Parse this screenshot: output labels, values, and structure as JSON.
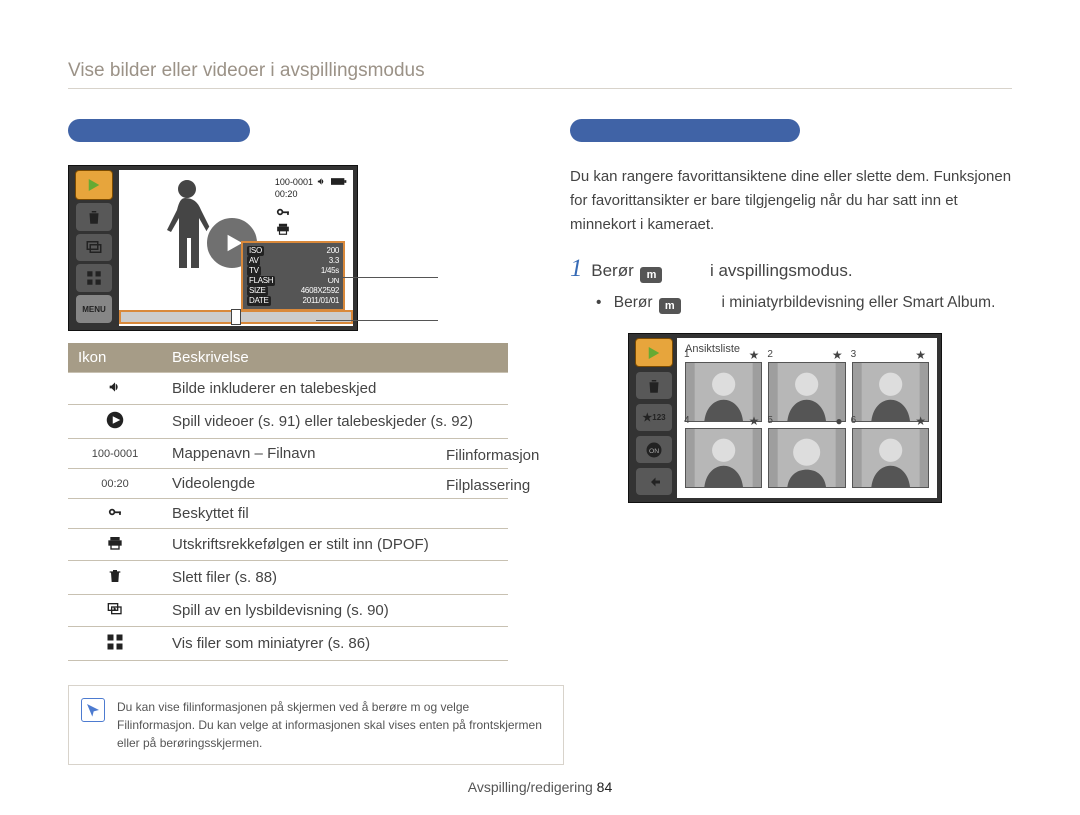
{
  "page_title": "Vise bilder eller videoer i avspillingsmodus",
  "left": {
    "section_heading": "",
    "lcd": {
      "file_id": "100-0001",
      "time": "00:20",
      "menu_label": "MENU",
      "info_box": {
        "iso_lbl": "ISO",
        "iso_val": "200",
        "av_lbl": "AV",
        "av_val": "3.3",
        "tv_lbl": "TV",
        "tv_val": "1/45s",
        "flash_lbl": "FLASH",
        "flash_val": "ON",
        "size_lbl": "SIZE",
        "size_val": "4608X2592",
        "date_lbl": "DATE",
        "date_val": "2011/01/01"
      }
    },
    "pointer_1": "Filinformasjon",
    "pointer_2": "Filplassering",
    "table_headers": {
      "icon": "Ikon",
      "desc": "Beskrivelse"
    },
    "rows": [
      {
        "icon_text": "",
        "icon_name": "voice-memo-icon",
        "desc": "Bilde inkluderer en talebeskjed"
      },
      {
        "icon_text": "",
        "icon_name": "play-circle-icon",
        "desc": "Spill videoer (s. 91) eller talebeskjeder (s. 92)"
      },
      {
        "icon_text": "100-0001",
        "icon_name": "",
        "desc": "Mappenavn – Filnavn"
      },
      {
        "icon_text": "00:20",
        "icon_name": "",
        "desc": "Videolengde"
      },
      {
        "icon_text": "",
        "icon_name": "key-icon",
        "desc": "Beskyttet ﬁl"
      },
      {
        "icon_text": "",
        "icon_name": "printer-icon",
        "desc": "Utskriftsrekkefølgen er stilt inn (DPOF)"
      },
      {
        "icon_text": "",
        "icon_name": "trash-icon",
        "desc": "Slett ﬁler (s. 88)"
      },
      {
        "icon_text": "",
        "icon_name": "slideshow-icon",
        "desc": "Spill av en lysbildevisning (s. 90)"
      },
      {
        "icon_text": "",
        "icon_name": "thumbnails-icon",
        "desc": "Vis ﬁler som miniatyrer (s. 86)"
      }
    ],
    "note": "Du kan vise ﬁlinformasjonen på skjermen ved å berøre m og velge Filinformasjon. Du kan velge at informasjonen skal vises enten på frontskjermen eller på berøringsskjermen."
  },
  "right": {
    "section_heading": "",
    "intro": "Du kan rangere favorittansiktene dine eller slette dem. Funksjonen for favorittansikter er bare tilgjengelig når du har satt inn et minnekort i kameraet.",
    "step_num": "1",
    "step_pre": "Berør",
    "step_icon": "m",
    "step_post": "i avspillingsmodus.",
    "substep_pre": "Berør",
    "substep_icon": "m",
    "substep_post": "i miniatyrbildevisning eller Smart Album.",
    "face_title": "Ansiktsliste",
    "face_numbers": [
      "1",
      "2",
      "3",
      "4",
      "5",
      "6"
    ]
  },
  "footer": {
    "section": "Avspilling/redigering",
    "page": "84"
  }
}
